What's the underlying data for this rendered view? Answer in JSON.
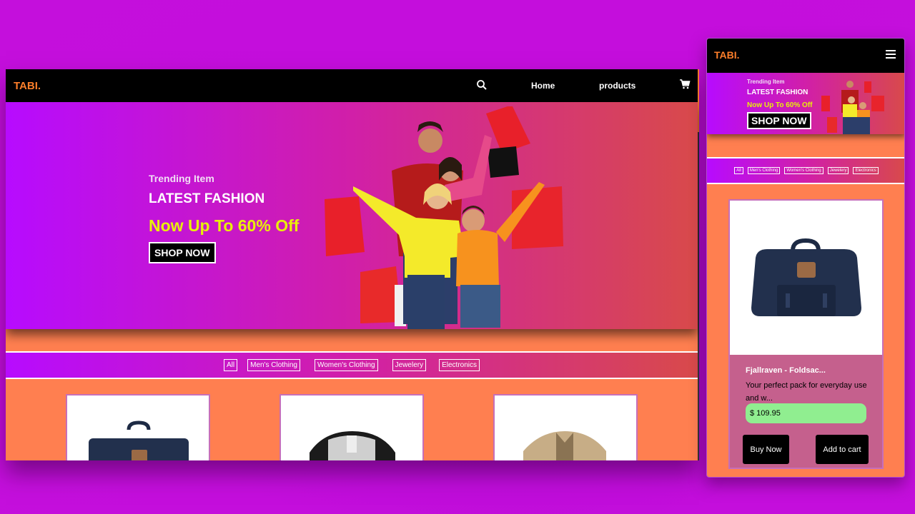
{
  "desktop": {
    "logo": "TABI.",
    "nav": {
      "home": "Home",
      "products": "products"
    },
    "hero": {
      "trending": "Trending Item",
      "title": "LATEST FASHION",
      "offer": "Now Up To 60% Off",
      "cta": "SHOP NOW"
    },
    "filters": [
      "All",
      "Men's Clothing",
      "Women's Clothing",
      "Jewelery",
      "Electronics"
    ]
  },
  "mobile": {
    "logo": "TABI.",
    "hero": {
      "trending": "Trending Item",
      "title": "LATEST FASHION",
      "offer": "Now Up To 60% Off",
      "cta": "SHOP NOW"
    },
    "filters": [
      "All",
      "Men's Clothing",
      "Women's Clothing",
      "Jewelery",
      "Electronics"
    ],
    "product": {
      "name": "Fjallraven - Foldsac...",
      "description": "Your perfect pack for everyday use and w...",
      "price": "$ 109.95",
      "buy": "Buy Now",
      "add": "Add to cart"
    }
  },
  "colors": {
    "background": "#c40edc",
    "accent_logo": "#ff7f2a",
    "offer_text": "#e8f00a",
    "content_bg": "#ff7f50",
    "price_bg": "#90ee90"
  },
  "icons": [
    "search-icon",
    "cart-icon",
    "hamburger-menu-icon"
  ]
}
